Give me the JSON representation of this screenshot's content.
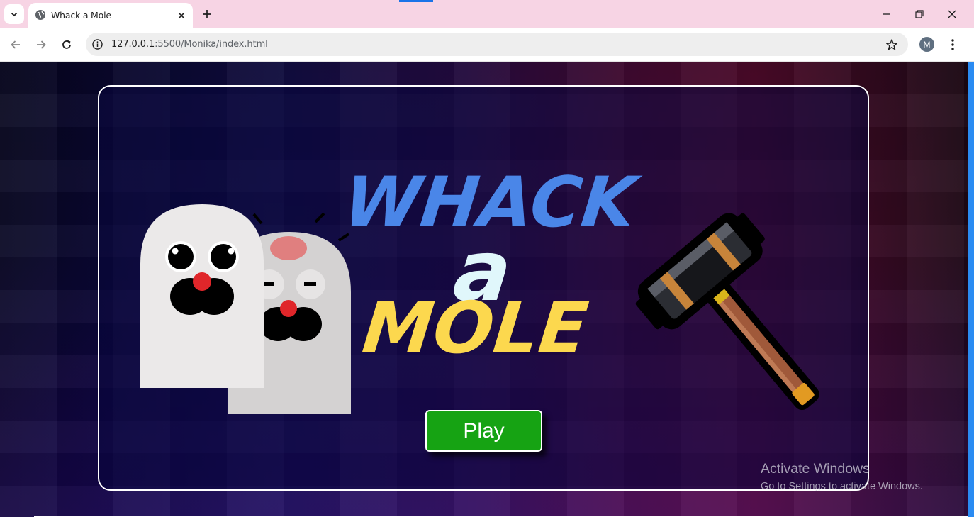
{
  "browser": {
    "tab_title": "Whack a Mole",
    "url_host": "127.0.0.1",
    "url_path": ":5500/Monika/index.html",
    "profile_initial": "M"
  },
  "game": {
    "title_lines": [
      "WHACK",
      "a",
      "MOLE"
    ],
    "title_colors": [
      "#4a86e8",
      "#e0f7fb",
      "#fcd84e"
    ],
    "play_button_label": "Play",
    "play_button_color": "#16a313"
  },
  "os_watermark": {
    "line1": "Activate Windows",
    "line2": "Go to Settings to activate Windows."
  },
  "icons": [
    "chevron-down-icon",
    "globe-icon",
    "close-icon",
    "plus-icon",
    "minimize-icon",
    "restore-icon",
    "back-icon",
    "forward-icon",
    "reload-icon",
    "site-info-icon",
    "star-icon",
    "kebab-menu-icon"
  ]
}
